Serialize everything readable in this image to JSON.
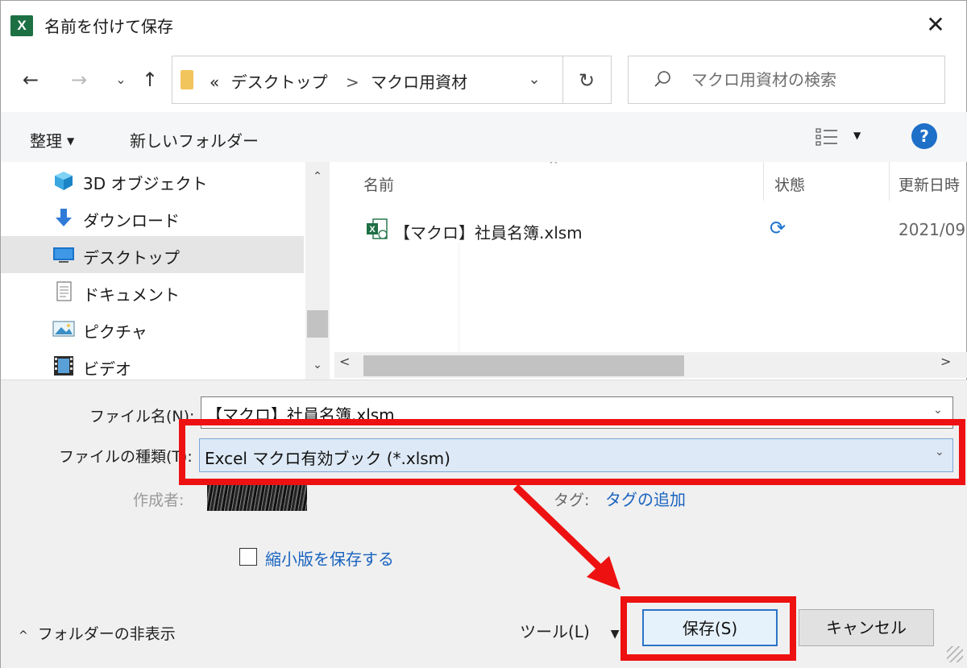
{
  "window": {
    "app_icon_text": "X",
    "title": "名前を付けて保存",
    "close_glyph": "✕"
  },
  "nav": {
    "back_glyph": "←",
    "forward_glyph": "→",
    "recent_glyph": "⌄",
    "up_glyph": "↑"
  },
  "address": {
    "overflow": "«",
    "crumbs": [
      "デスクトップ",
      "マクロ用資材"
    ],
    "separator": ">",
    "dropdown_glyph": "⌄",
    "refresh_glyph": "↻"
  },
  "search": {
    "placeholder": "マクロ用資材の検索"
  },
  "commands": {
    "organize": "整理",
    "organize_caret": "▼",
    "new_folder": "新しいフォルダー",
    "view_caret": "▼",
    "help": "?"
  },
  "navpane": {
    "items": [
      {
        "label": "3D オブジェクト",
        "icon": "cube-icon"
      },
      {
        "label": "ダウンロード",
        "icon": "download-icon"
      },
      {
        "label": "デスクトップ",
        "icon": "desktop-icon",
        "selected": true
      },
      {
        "label": "ドキュメント",
        "icon": "document-icon"
      },
      {
        "label": "ピクチャ",
        "icon": "picture-icon"
      },
      {
        "label": "ビデオ",
        "icon": "video-icon"
      }
    ],
    "scroll_up": "⌃",
    "scroll_down": "⌄"
  },
  "filelist": {
    "columns": [
      "名前",
      "状態",
      "更新日時"
    ],
    "sort_caret": "^",
    "rows": [
      {
        "name": "【マクロ】社員名簿.xlsm",
        "status_icon": "sync-icon",
        "status_glyph": "⟳",
        "date": "2021/09"
      }
    ],
    "scroll_left": "<",
    "scroll_right": ">"
  },
  "form": {
    "filename_label": "ファイル名(N):",
    "filename_value": "【マクロ】社員名簿.xlsm",
    "filetype_label": "ファイルの種類(T):",
    "filetype_value": "Excel マクロ有効ブック (*.xlsm)",
    "dropdown_glyph": "⌄",
    "author_label": "作成者:",
    "tag_label": "タグ:",
    "tag_link": "タグの追加",
    "thumbnail_label": "縮小版を保存する",
    "hide_folders": "フォルダーの非表示",
    "hide_caret": "^",
    "tools": "ツール(L)",
    "tools_caret": "▼",
    "save": "保存(S)",
    "cancel": "キャンセル"
  },
  "colors": {
    "annotation_red": "#ee1111",
    "accent_blue": "#1d6fc8",
    "excel_green": "#1d7044"
  }
}
